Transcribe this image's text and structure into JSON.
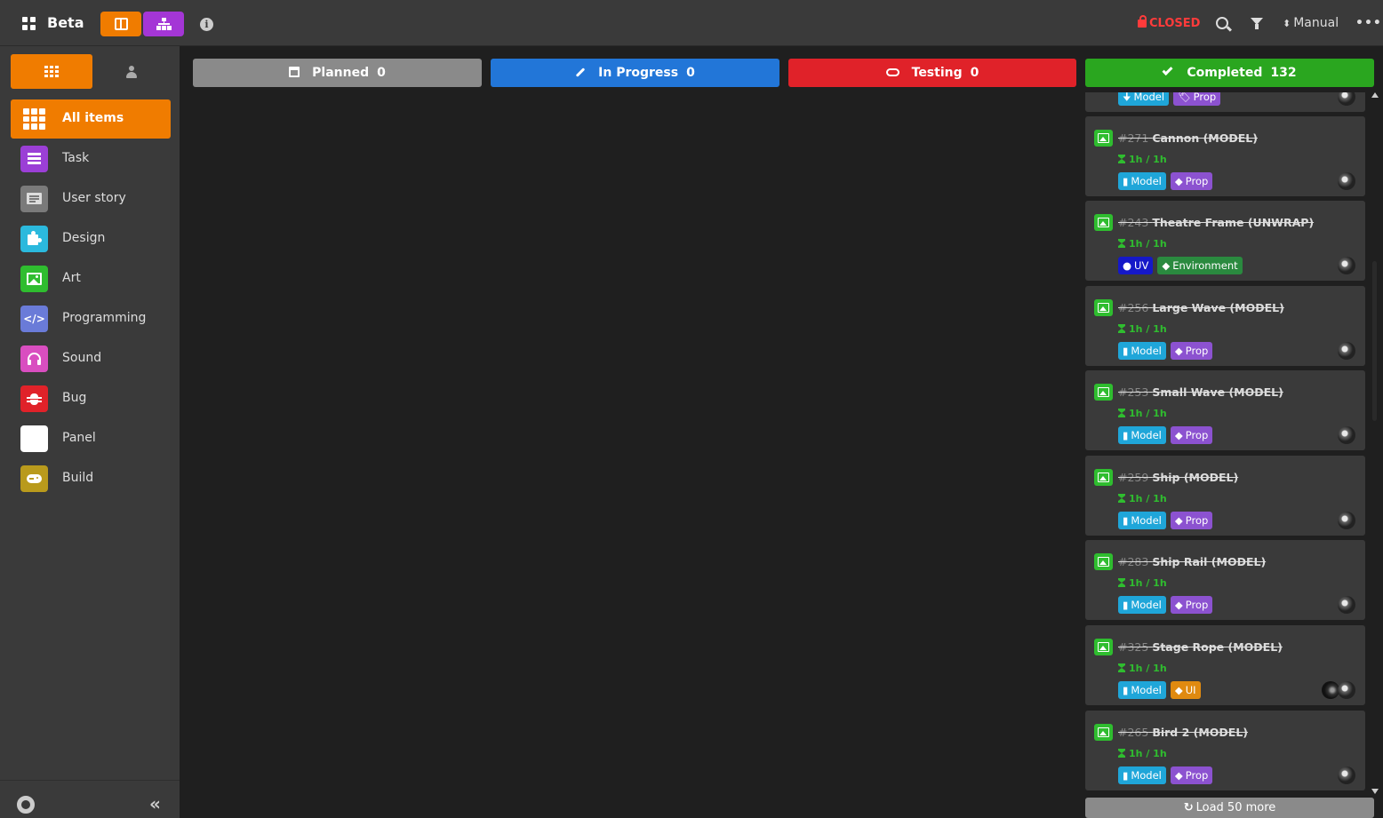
{
  "header": {
    "title": "Beta",
    "status": "CLOSED",
    "sort_label": "Manual"
  },
  "sidebar": {
    "items": [
      {
        "label": "All items",
        "color": "#f07c00",
        "icon": "grid-icon"
      },
      {
        "label": "Task",
        "color": "#9b3fd6",
        "icon": "task-icon"
      },
      {
        "label": "User story",
        "color": "#7a7a7a",
        "icon": "user-story-icon"
      },
      {
        "label": "Design",
        "color": "#2bb9dd",
        "icon": "puzzle-icon"
      },
      {
        "label": "Art",
        "color": "#2fbd2f",
        "icon": "image-icon"
      },
      {
        "label": "Programming",
        "color": "#6a7bd8",
        "icon": "code-icon"
      },
      {
        "label": "Sound",
        "color": "#d94ec0",
        "icon": "headphones-icon"
      },
      {
        "label": "Bug",
        "color": "#e02229",
        "icon": "bug-icon"
      },
      {
        "label": "Panel",
        "color": "#ffffff",
        "icon": "panel-icon"
      },
      {
        "label": "Build",
        "color": "#b99a1c",
        "icon": "gamepad-icon"
      }
    ]
  },
  "columns": [
    {
      "label": "Planned",
      "count": "0",
      "color": "#8a8a8a"
    },
    {
      "label": "In Progress",
      "count": "0",
      "color": "#2276d8"
    },
    {
      "label": "Testing",
      "count": "0",
      "color": "#e02229"
    },
    {
      "label": "Completed",
      "count": "132",
      "color": "#2aa61f"
    }
  ],
  "cards": [
    {
      "num": "#271",
      "name": "Cannon (MODEL)",
      "time": "1h / 1h",
      "tags": [
        "Model",
        "Prop"
      ]
    },
    {
      "num": "#243",
      "name": "Theatre Frame (UNWRAP)",
      "time": "1h / 1h",
      "tags": [
        "UV",
        "Environment"
      ]
    },
    {
      "num": "#256",
      "name": "Large Wave (MODEL)",
      "time": "1h / 1h",
      "tags": [
        "Model",
        "Prop"
      ]
    },
    {
      "num": "#253",
      "name": "Small Wave (MODEL)",
      "time": "1h / 1h",
      "tags": [
        "Model",
        "Prop"
      ]
    },
    {
      "num": "#259",
      "name": "Ship (MODEL)",
      "time": "1h / 1h",
      "tags": [
        "Model",
        "Prop"
      ]
    },
    {
      "num": "#283",
      "name": "Ship Rail (MODEL)",
      "time": "1h / 1h",
      "tags": [
        "Model",
        "Prop"
      ]
    },
    {
      "num": "#325",
      "name": "Stage Rope (MODEL)",
      "time": "1h / 1h",
      "tags": [
        "Model",
        "UI"
      ]
    },
    {
      "num": "#265",
      "name": "Bird 2 (MODEL)",
      "time": "1h / 1h",
      "tags": [
        "Model",
        "Prop"
      ]
    }
  ],
  "partial_card_tags": [
    "Model",
    "Prop"
  ],
  "load_more_label": "Load 50 more"
}
